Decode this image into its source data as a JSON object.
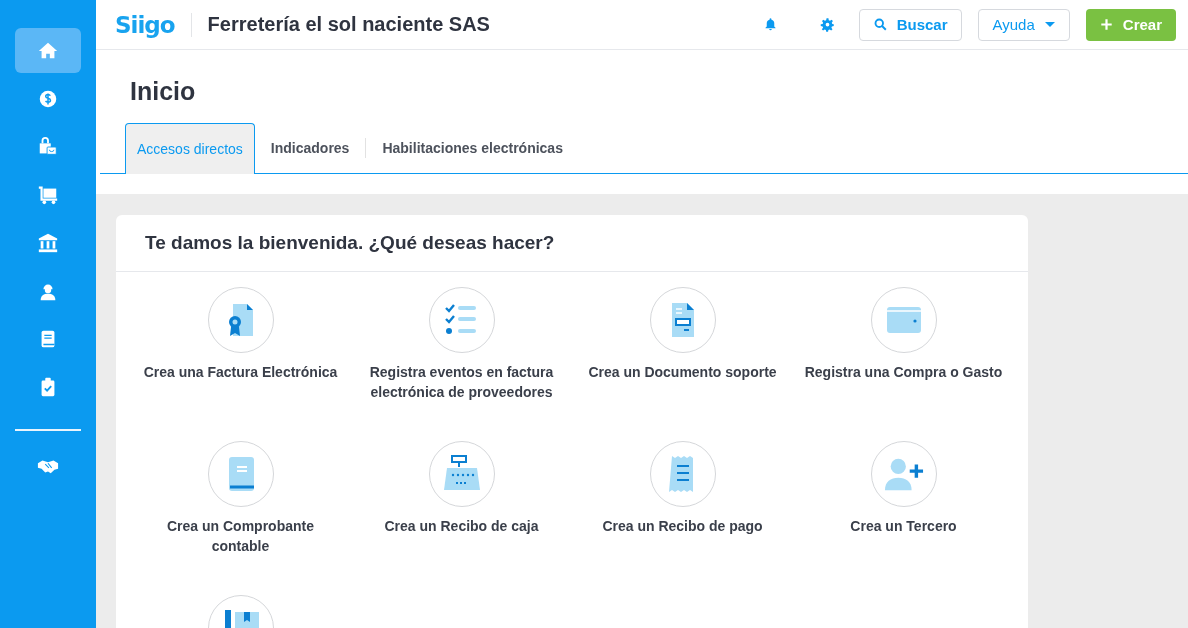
{
  "sidebar": {
    "items": [
      {
        "selected": true
      },
      {
        "selected": false
      },
      {
        "selected": false
      },
      {
        "selected": false
      },
      {
        "selected": false
      },
      {
        "selected": false
      },
      {
        "selected": false
      },
      {
        "selected": false
      }
    ],
    "bottom_items": [
      {
        "selected": false
      }
    ]
  },
  "header": {
    "logo": "Siigo",
    "company": "Ferretería el sol naciente SAS",
    "search_button": "Buscar",
    "help_button": "Ayuda",
    "create_button": "Crear"
  },
  "page": {
    "title": "Inicio"
  },
  "tabs": [
    {
      "label": "Accesos directos",
      "selected": true
    },
    {
      "label": "Indicadores",
      "selected": false
    },
    {
      "label": "Habilitaciones electrónicas",
      "selected": false
    }
  ],
  "card": {
    "title": "Te damos la bienvenida. ¿Qué deseas hacer?",
    "shortcuts": [
      {
        "kind": "labeled",
        "label": "Crea una Factura Electrónica"
      },
      {
        "kind": "labeled",
        "label": "Registra eventos en factura electrónica de proveedores"
      },
      {
        "kind": "labeled",
        "label": "Crea un Documento soporte"
      },
      {
        "kind": "labeled",
        "label": "Registra una Compra o Gasto"
      },
      {
        "kind": "labeled",
        "label": "Crea un Comprobante contable"
      },
      {
        "kind": "labeled",
        "label": "Crea un Recibo de caja"
      },
      {
        "kind": "labeled",
        "label": "Crea un Recibo de pago"
      },
      {
        "kind": "labeled",
        "label": "Crea un Tercero"
      },
      {
        "kind": "icon"
      }
    ]
  }
}
